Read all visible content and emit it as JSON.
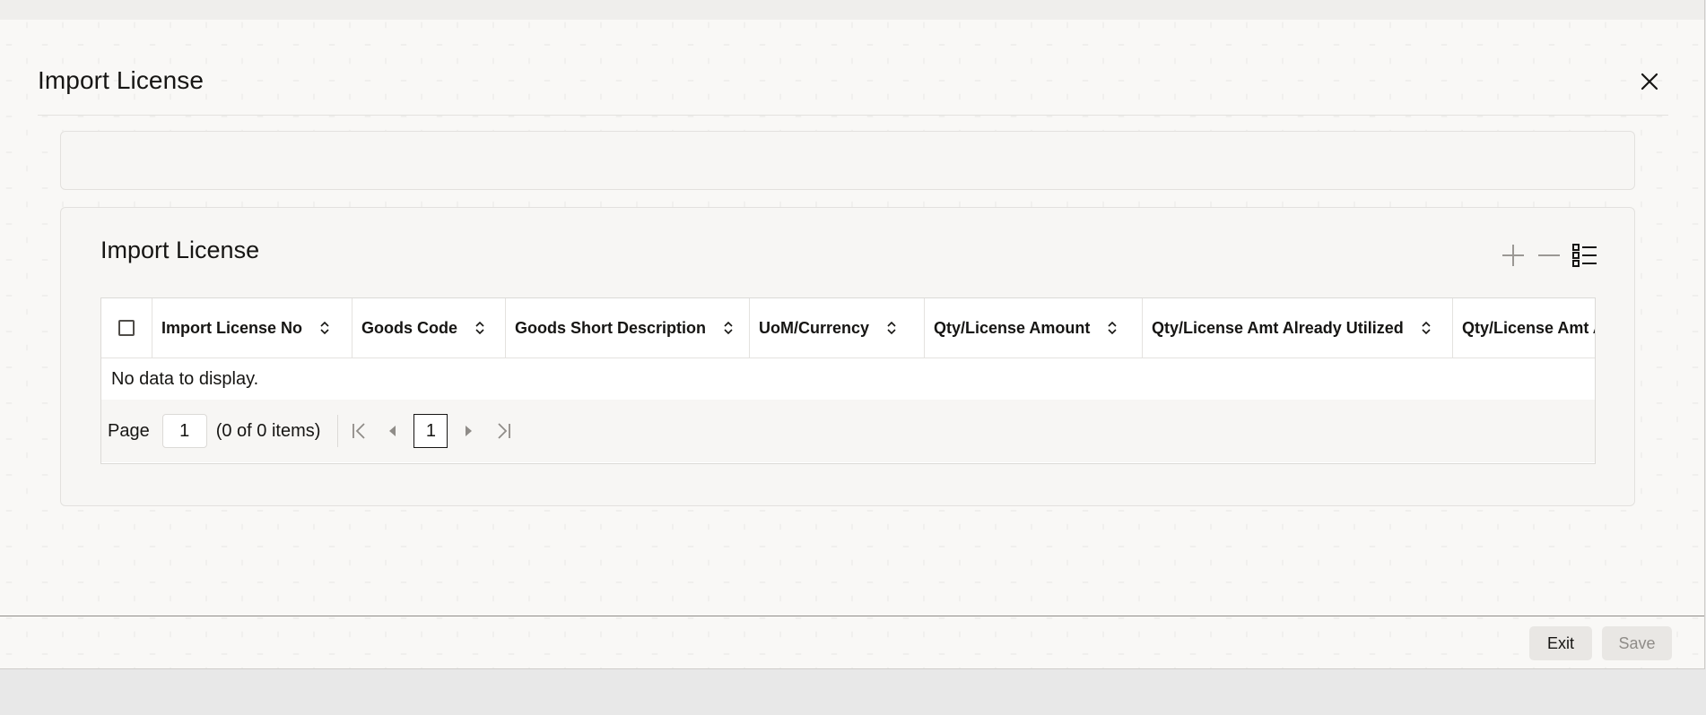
{
  "dialog": {
    "title": "Import License",
    "close_icon": "close-icon"
  },
  "section": {
    "title": "Import License",
    "toolbar": {
      "add_icon": "plus-icon",
      "delete_icon": "minus-icon",
      "view_icon": "list-view-icon"
    }
  },
  "table": {
    "columns": [
      {
        "label": "Import License No"
      },
      {
        "label": "Goods Code"
      },
      {
        "label": "Goods Short Description"
      },
      {
        "label": "UoM/Currency"
      },
      {
        "label": "Qty/License Amount"
      },
      {
        "label": "Qty/License Amt Already Utilized"
      },
      {
        "label": "Qty/License Amt A"
      }
    ],
    "empty_message": "No data to display."
  },
  "pager": {
    "page_label": "Page",
    "page_value": "1",
    "count_text": "(0 of 0 items)",
    "current_page": "1"
  },
  "footer": {
    "exit_label": "Exit",
    "save_label": "Save"
  }
}
